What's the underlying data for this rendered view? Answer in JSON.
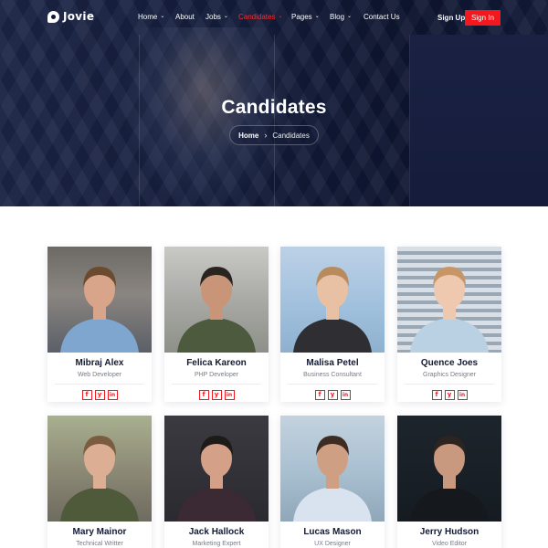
{
  "brand": {
    "name": "Jovie"
  },
  "nav": {
    "items": [
      {
        "label": "Home",
        "has_caret": true,
        "active": false
      },
      {
        "label": "About",
        "has_caret": false,
        "active": false
      },
      {
        "label": "Jobs",
        "has_caret": true,
        "active": false
      },
      {
        "label": "Candidates",
        "has_caret": true,
        "active": true
      },
      {
        "label": "Pages",
        "has_caret": true,
        "active": false
      },
      {
        "label": "Blog",
        "has_caret": true,
        "active": false
      },
      {
        "label": "Contact Us",
        "has_caret": false,
        "active": false
      }
    ],
    "signup_label": "Sign Up",
    "signin_label": "Sign In"
  },
  "hero": {
    "title": "Candidates",
    "breadcrumb": {
      "home": "Home",
      "current": "Candidates"
    }
  },
  "colors": {
    "accent": "#f2181d",
    "hero_bg": "#0f1733"
  },
  "candidates": [
    {
      "name": "Mibraj Alex",
      "role": "Web Developer",
      "socials": [
        "facebook-icon",
        "twitter-icon",
        "linkedin-icon"
      ]
    },
    {
      "name": "Felica Kareon",
      "role": "PHP Developer",
      "socials": [
        "facebook-icon",
        "twitter-icon",
        "linkedin-icon"
      ]
    },
    {
      "name": "Malisa Petel",
      "role": "Business Consultant",
      "socials": [
        "facebook-icon",
        "twitter-icon",
        "linkedin-icon"
      ]
    },
    {
      "name": "Quence Joes",
      "role": "Graphics Designer",
      "socials": [
        "facebook-icon",
        "twitter-icon",
        "linkedin-icon"
      ]
    },
    {
      "name": "Mary Mainor",
      "role": "Technical Writter",
      "socials": [
        "facebook-icon",
        "twitter-icon",
        "linkedin-icon"
      ]
    },
    {
      "name": "Jack Hallock",
      "role": "Marketing Expert",
      "socials": [
        "facebook-icon",
        "twitter-icon",
        "linkedin-icon"
      ]
    },
    {
      "name": "Lucas Mason",
      "role": "UX Designer",
      "socials": [
        "facebook-icon",
        "twitter-icon",
        "linkedin-icon"
      ]
    },
    {
      "name": "Jerry Hudson",
      "role": "Video Editor",
      "socials": [
        "facebook-icon",
        "twitter-icon",
        "linkedin-icon"
      ]
    }
  ]
}
